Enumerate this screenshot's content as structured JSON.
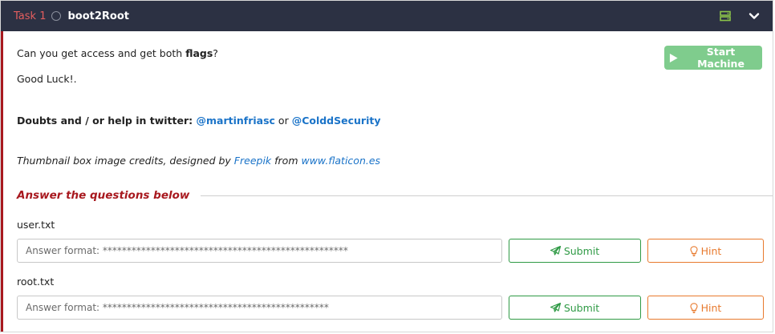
{
  "task": {
    "number_label": "Task 1",
    "title": "boot2Root"
  },
  "header_icons": {
    "server": "server-icon",
    "chevron": "chevron-down-icon",
    "accent": "#8bc34a"
  },
  "content": {
    "line1_prefix": "Can you get access and get both ",
    "line1_bold": "flags",
    "line1_suffix": "?",
    "line2": "Good Luck!.",
    "line3_prefix": "Doubts and / or help in twitter: ",
    "line3_link1": "@martinfriasc",
    "line3_mid": " or ",
    "line3_link2": "@ColddSecurity",
    "line4_prefix": "Thumbnail box image credits, designed by ",
    "line4_link1": "Freepik",
    "line4_mid": " from ",
    "line4_link2": "www.flaticon.es"
  },
  "start_machine": {
    "label": "Start Machine",
    "color": "#7fcc8d"
  },
  "answers": {
    "heading": "Answer the questions below",
    "questions": [
      {
        "label": "user.txt",
        "placeholder": "Answer format: ***************************************************",
        "submit_label": "Submit",
        "hint_label": "Hint"
      },
      {
        "label": "root.txt",
        "placeholder": "Answer format: ***********************************************",
        "submit_label": "Submit",
        "hint_label": "Hint"
      }
    ]
  },
  "colors": {
    "header_bg": "#2c3143",
    "task_number": "#e35e5e",
    "accent_red": "#a8191f",
    "link": "#1a73c8",
    "submit": "#2f9a45",
    "hint": "#e87a2e"
  }
}
